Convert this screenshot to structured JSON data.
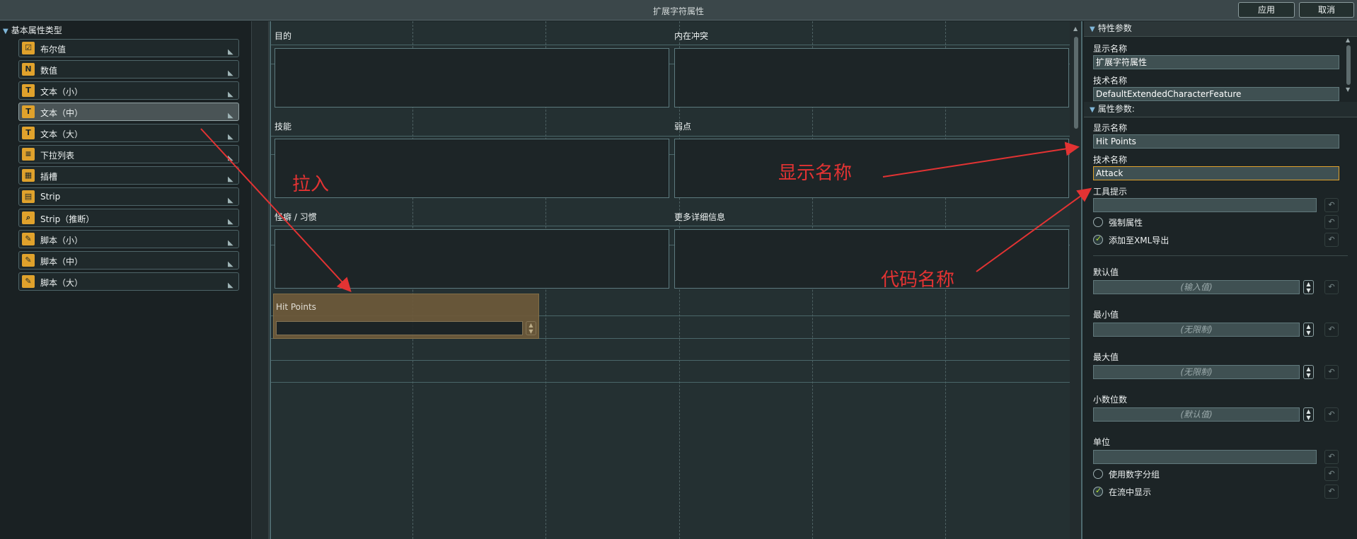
{
  "window": {
    "title": "扩展字符属性",
    "apply_label": "应用",
    "cancel_label": "取消"
  },
  "left_panel": {
    "header": "基本属性类型",
    "items": [
      {
        "label": "布尔值",
        "icon": "checkbox-icon",
        "glyph": "☑"
      },
      {
        "label": "数值",
        "icon": "number-icon",
        "glyph": "N"
      },
      {
        "label": "文本（小）",
        "icon": "text-small-icon",
        "glyph": "T"
      },
      {
        "label": "文本（中）",
        "icon": "text-medium-icon",
        "glyph": "T",
        "selected": true
      },
      {
        "label": "文本（大）",
        "icon": "text-large-icon",
        "glyph": "T"
      },
      {
        "label": "下拉列表",
        "icon": "dropdown-list-icon",
        "glyph": "≡"
      },
      {
        "label": "插槽",
        "icon": "slot-icon",
        "glyph": "▦"
      },
      {
        "label": "Strip",
        "icon": "strip-icon",
        "glyph": "▤"
      },
      {
        "label": "Strip（推断）",
        "icon": "strip-infer-icon",
        "glyph": "⌕"
      },
      {
        "label": "脚本（小）",
        "icon": "script-small-icon",
        "glyph": "✎"
      },
      {
        "label": "脚本（中）",
        "icon": "script-medium-icon",
        "glyph": "✎"
      },
      {
        "label": "脚本（大）",
        "icon": "script-large-icon",
        "glyph": "✎"
      }
    ]
  },
  "canvas": {
    "fields": [
      "目的",
      "内在冲突",
      "技能",
      "弱点",
      "怪癖 / 习惯",
      "更多详细信息"
    ],
    "new_field": {
      "label": "Hit Points"
    }
  },
  "right_panel": {
    "section1": "特性参数",
    "display_name_label": "显示名称",
    "display_name_value": "扩展字符属性",
    "tech_name_label": "技术名称",
    "tech_name_value": "DefaultExtendedCharacterFeature",
    "section2": "属性参数:",
    "attr_display_name_label": "显示名称",
    "attr_display_name_value": "Hit Points",
    "attr_tech_name_label": "技术名称",
    "attr_tech_name_value": "Attack",
    "tooltip_label": "工具提示",
    "tooltip_value": "",
    "mandatory_label": "强制属性",
    "mandatory_checked": false,
    "xml_export_label": "添加至XML导出",
    "xml_export_checked": true,
    "default_label": "默认值",
    "default_placeholder": "(输入值)",
    "min_label": "最小值",
    "min_placeholder": "(无限制)",
    "max_label": "最大值",
    "max_placeholder": "(无限制)",
    "decimals_label": "小数位数",
    "decimals_placeholder": "(默认值)",
    "unit_label": "单位",
    "unit_value": "",
    "digit_group_label": "使用数字分组",
    "digit_group_checked": false,
    "show_in_flow_label": "在流中显示",
    "show_in_flow_checked": true
  },
  "annotations": {
    "drag_in": "拉入",
    "display_name": "显示名称",
    "code_name": "代码名称"
  },
  "colors": {
    "accent": "#e0a22c",
    "annotation": "#e33333",
    "check": "#b7e234"
  }
}
